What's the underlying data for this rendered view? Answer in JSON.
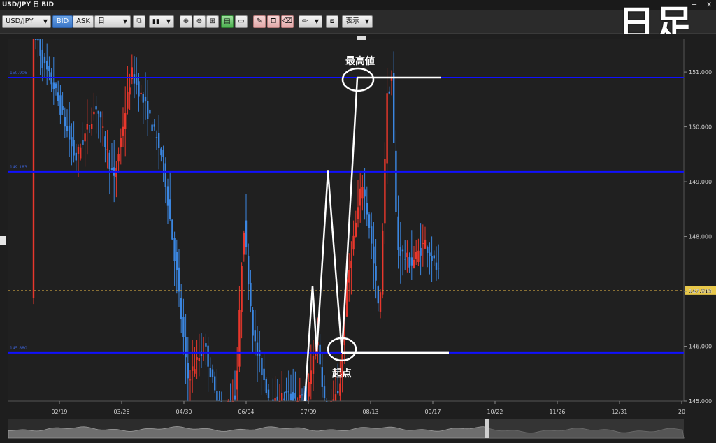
{
  "window": {
    "title": "USD/JPY 日 BID",
    "close_icon": "close-icon",
    "minimize_icon": "minimize-icon"
  },
  "toolbar": {
    "symbol": "USD/JPY",
    "bid_label": "BID",
    "ask_label": "ASK",
    "period": "日",
    "display_label": "表示",
    "icons": [
      "candlestick-icon",
      "zoom-in-icon",
      "zoom-out-icon",
      "split-view-icon",
      "grid-icon",
      "window-icon",
      "draw-add-icon",
      "draw-copy-icon",
      "draw-remove-icon",
      "pen-icon",
      "screenshot-icon"
    ]
  },
  "overlay_label": "日足",
  "annotations": {
    "high": "最高値",
    "start": "起点"
  },
  "colors": {
    "up": "#e8372c",
    "down": "#3b86e0",
    "level_line": "#1010ff",
    "current_price_line": "#c8a040",
    "price_tag": "#e8c84a",
    "background": "#1c1c1c"
  },
  "chart_data": {
    "type": "candlestick",
    "instrument": "USD/JPY",
    "timeframe": "日",
    "price_side": "BID",
    "y_ticks": [
      "151.000",
      "150.000",
      "149.000",
      "148.000",
      "147.000",
      "146.000",
      "145.000"
    ],
    "ylim": [
      145.0,
      151.6
    ],
    "x_ticks": [
      "02/19",
      "03/26",
      "04/30",
      "06/04",
      "07/09",
      "08/13",
      "09/17",
      "10/22",
      "11/26",
      "12/31",
      "20"
    ],
    "current_price": "147.015",
    "levels": [
      {
        "value": 150.9,
        "label": "150.906"
      },
      {
        "value": 149.18,
        "label": "149.183"
      },
      {
        "value": 145.88,
        "label": "145.880"
      }
    ],
    "annotation_high": 150.9,
    "annotation_start": 145.88
  }
}
